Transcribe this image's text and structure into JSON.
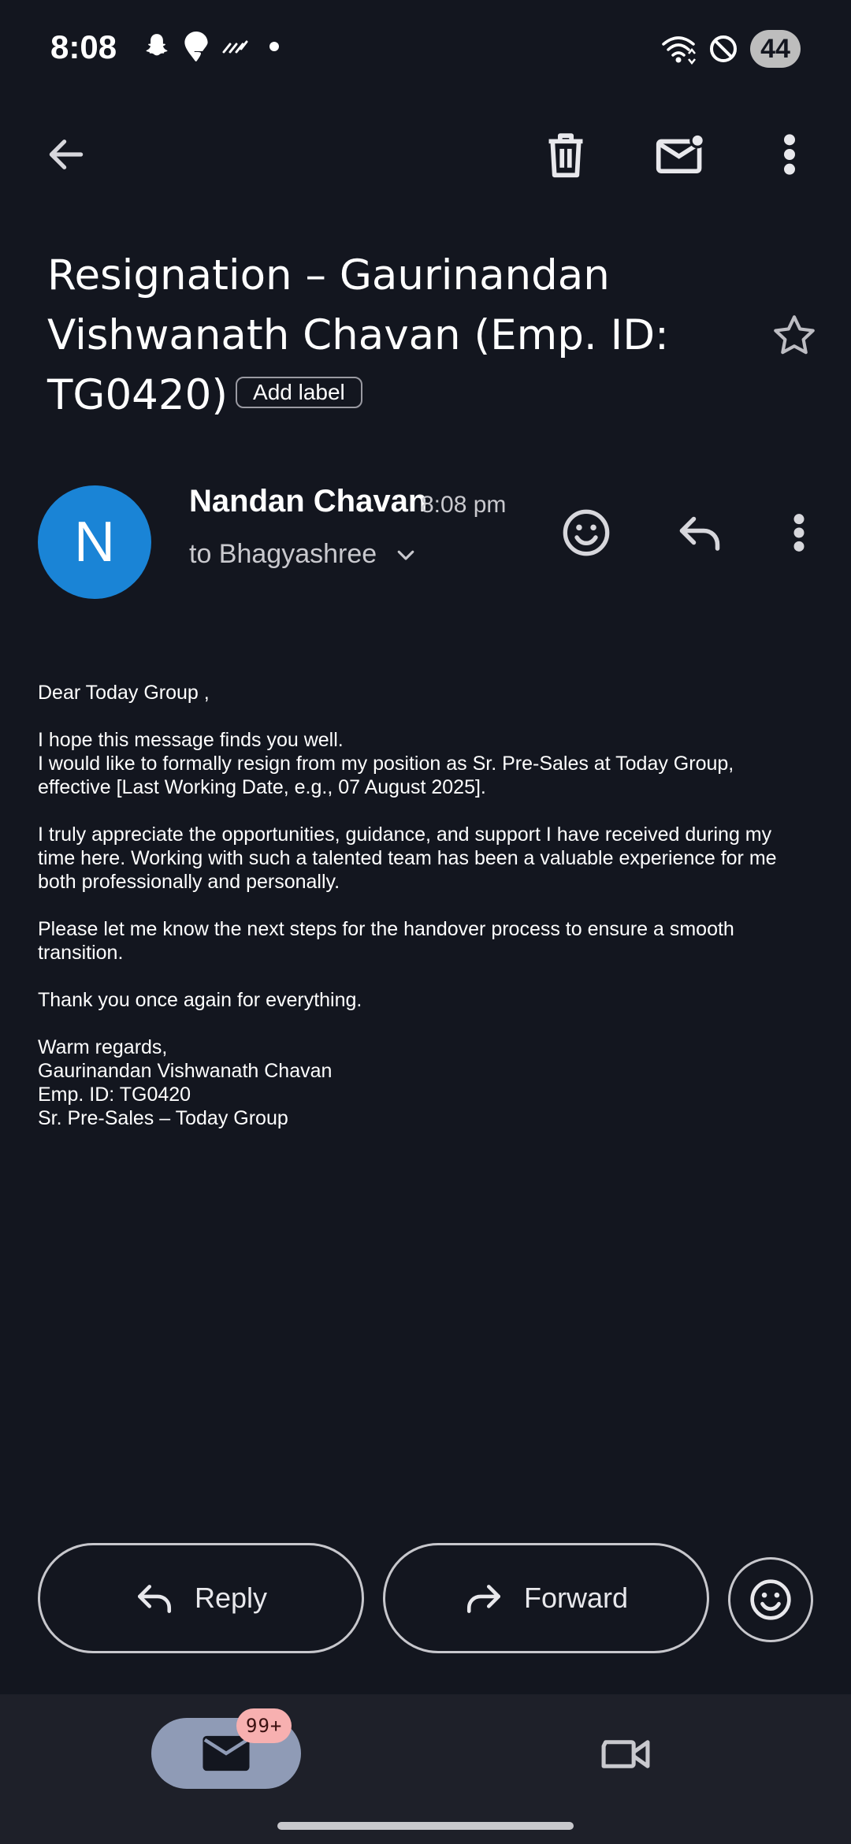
{
  "status_bar": {
    "time": "8:08",
    "battery": "44",
    "icons": [
      "snapchat-icon",
      "swiggy-icon",
      "signal-lines-icon",
      "notification-dot-icon",
      "wifi-icon",
      "do-not-disturb-icon"
    ]
  },
  "toolbar": {
    "icons": [
      "back-arrow-icon",
      "delete-icon",
      "mark-unread-icon",
      "more-vert-icon"
    ]
  },
  "email": {
    "subject": "Resignation – Gaurinandan Vishwanath Chavan (Emp. ID: TG0420)",
    "add_label": "Add label",
    "sender": {
      "avatar_letter": "N",
      "avatar_color": "#1a84d6",
      "name": "Nandan Chavan",
      "time": "8:08 pm",
      "recipient": "to Bhagyashree"
    },
    "body": [
      "Dear Today Group ,",
      "",
      "I hope this message finds you well.",
      "I would like to formally resign from my position as Sr. Pre-Sales at Today Group,",
      "effective [Last Working Date, e.g., 07 August 2025].",
      "",
      "I truly appreciate the opportunities, guidance, and support I have received during my",
      "time here. Working with such a talented team has been a valuable experience for me",
      "both professionally and personally.",
      "",
      "Please let me know the next steps for the handover process to ensure a smooth",
      "transition.",
      "",
      "Thank you once again for everything.",
      "",
      "Warm regards,",
      "Gaurinandan Vishwanath Chavan",
      "Emp. ID: TG0420",
      "Sr. Pre-Sales – Today Group"
    ]
  },
  "actions": {
    "reply_label": "Reply",
    "forward_label": "Forward"
  },
  "bottom_nav": {
    "mail_badge": "99+",
    "accent": "#8f9bb6"
  }
}
